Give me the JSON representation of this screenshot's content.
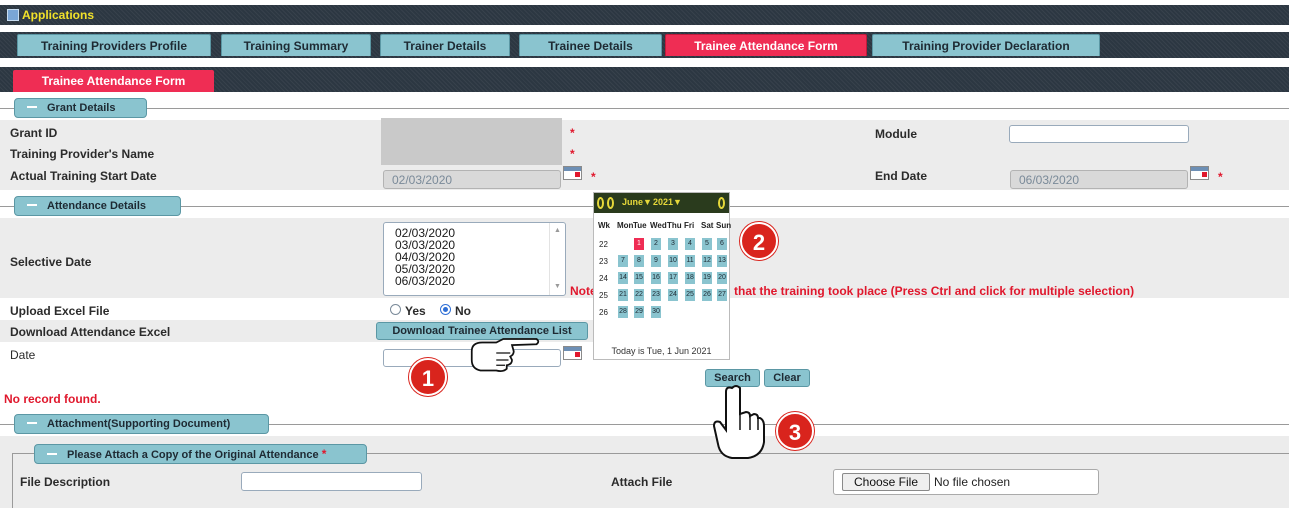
{
  "app": {
    "title": "Applications",
    "icon": "window-icon"
  },
  "tabs": [
    {
      "label": "Training Providers Profile",
      "active": false
    },
    {
      "label": "Training Summary",
      "active": false
    },
    {
      "label": "Trainer Details",
      "active": false
    },
    {
      "label": "Trainee Details",
      "active": false
    },
    {
      "label": "Trainee Attendance Form",
      "active": true
    },
    {
      "label": "Training Provider Declaration",
      "active": false
    }
  ],
  "subtab": {
    "label": "Trainee Attendance Form"
  },
  "grant": {
    "header": "Grant Details",
    "grant_id_label": "Grant ID",
    "provider_name_label": "Training Provider's Name",
    "start_date_label": "Actual Training Start Date",
    "start_date_value": "02/03/2020",
    "module_label": "Module",
    "module_value": "",
    "end_date_label": "End Date",
    "end_date_value": "06/03/2020",
    "required_mark": "*"
  },
  "attendance": {
    "header": "Attendance Details",
    "selective_date_label": "Selective Date",
    "dates": [
      "02/03/2020",
      "03/03/2020",
      "04/03/2020",
      "05/03/2020",
      "06/03/2020"
    ],
    "note_prefix": "Note",
    "note_suffix": "that the training took place (Press Ctrl and click for multiple selection)",
    "upload_label": "Upload Excel File",
    "yes_label": "Yes",
    "no_label": "No",
    "selected": "No",
    "download_label": "Download Attendance Excel",
    "download_button": "Download Trainee Attendance List",
    "date_label": "Date",
    "date_value": "",
    "search_button": "Search",
    "clear_button": "Clear",
    "no_record": "No record found."
  },
  "calendar": {
    "month": "June",
    "year": "2021",
    "weekday_headers": [
      "Wk",
      "Mon",
      "Tue",
      "Wed",
      "Thu",
      "Fri",
      "Sat",
      "Sun"
    ],
    "weeks": [
      {
        "wk": "22",
        "days": [
          "",
          "1",
          "2",
          "3",
          "4",
          "5",
          "6"
        ]
      },
      {
        "wk": "23",
        "days": [
          "7",
          "8",
          "9",
          "10",
          "11",
          "12",
          "13"
        ]
      },
      {
        "wk": "24",
        "days": [
          "14",
          "15",
          "16",
          "17",
          "18",
          "19",
          "20"
        ]
      },
      {
        "wk": "25",
        "days": [
          "21",
          "22",
          "23",
          "24",
          "25",
          "26",
          "27"
        ]
      },
      {
        "wk": "26",
        "days": [
          "28",
          "29",
          "30",
          "",
          "",
          "",
          ""
        ]
      }
    ],
    "today_day": "1",
    "footer": "Today is Tue, 1 Jun 2021"
  },
  "attachment": {
    "header": "Attachment(Supporting Document)",
    "subheader": "Please Attach a Copy of the Original Attendance",
    "required_mark": "*",
    "file_desc_label": "File Description",
    "file_desc_value": "",
    "attach_label": "Attach File",
    "choose_button": "Choose File",
    "no_file": "No file chosen"
  },
  "annotations": {
    "step1": "1",
    "step2": "2",
    "step3": "3"
  },
  "colors": {
    "header_bg": "#2c3742",
    "tab": "#8ac4cf",
    "active_tab": "#ef2d54",
    "title_yellow": "#f2e22a",
    "badge_red": "#d9241d"
  }
}
